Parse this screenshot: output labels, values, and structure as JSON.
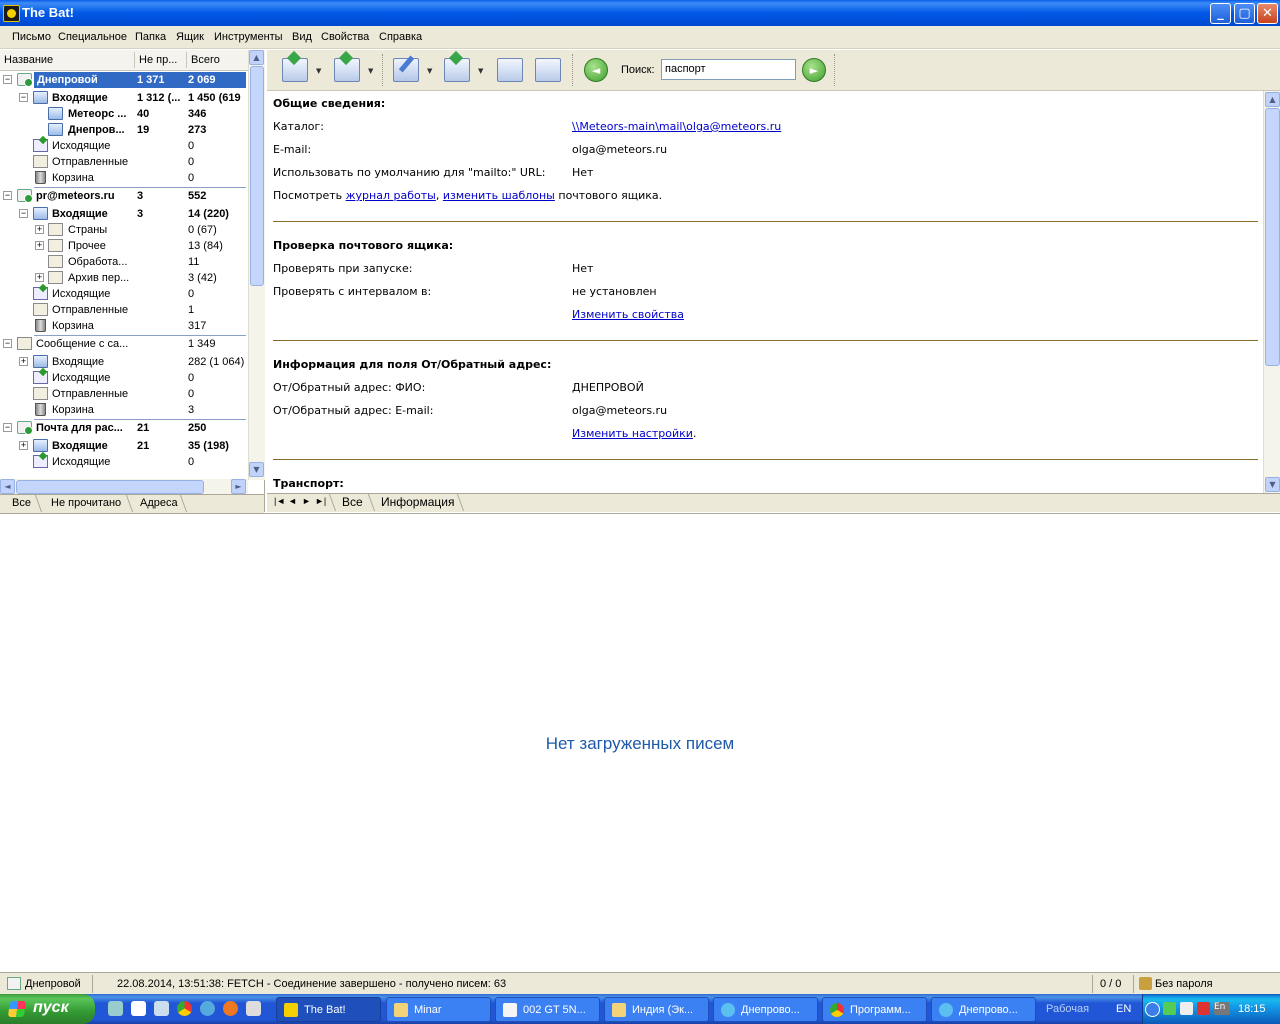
{
  "window": {
    "title": "The Bat!"
  },
  "menu": [
    "Письмо",
    "Специальное",
    "Папка",
    "Ящик",
    "Инструменты",
    "Вид",
    "Свойства",
    "Справка"
  ],
  "tree": {
    "headers": {
      "name": "Название",
      "unread": "Не пр...",
      "total": "Всего"
    },
    "rows": [
      {
        "name": "Днепровой",
        "unread": "1 371",
        "total": "2 069"
      },
      {
        "name": "Входящие",
        "unread": "1 312 (...",
        "total": "1 450 (619"
      },
      {
        "name": "Метеорс ...",
        "unread": "40",
        "total": "346"
      },
      {
        "name": "Днепров...",
        "unread": "19",
        "total": "273"
      },
      {
        "name": "Исходящие",
        "unread": "",
        "total": "0"
      },
      {
        "name": "Отправленные",
        "unread": "",
        "total": "0"
      },
      {
        "name": "Корзина",
        "unread": "",
        "total": "0"
      },
      {
        "name": "pr@meteors.ru",
        "unread": "3",
        "total": "552"
      },
      {
        "name": "Входящие",
        "unread": "3",
        "total": "14 (220)"
      },
      {
        "name": "Страны",
        "unread": "",
        "total": "0 (67)"
      },
      {
        "name": "Прочее",
        "unread": "",
        "total": "13 (84)"
      },
      {
        "name": "Обработа...",
        "unread": "",
        "total": "11"
      },
      {
        "name": "Архив пер...",
        "unread": "",
        "total": "3 (42)"
      },
      {
        "name": "Исходящие",
        "unread": "",
        "total": "0"
      },
      {
        "name": "Отправленные",
        "unread": "",
        "total": "1"
      },
      {
        "name": "Корзина",
        "unread": "",
        "total": "317"
      },
      {
        "name": "Сообщение с са...",
        "unread": "",
        "total": "1 349"
      },
      {
        "name": "Входящие",
        "unread": "",
        "total": "282 (1 064)"
      },
      {
        "name": "Исходящие",
        "unread": "",
        "total": "0"
      },
      {
        "name": "Отправленные",
        "unread": "",
        "total": "0"
      },
      {
        "name": "Корзина",
        "unread": "",
        "total": "3"
      },
      {
        "name": "Почта для рас...",
        "unread": "21",
        "total": "250"
      },
      {
        "name": "Входящие",
        "unread": "21",
        "total": "35 (198)"
      },
      {
        "name": "Исходящие",
        "unread": "",
        "total": "0"
      }
    ],
    "tabs": [
      "Все",
      "Не прочитано",
      "Адреса"
    ]
  },
  "toolbar": {
    "search_label": "Поиск:",
    "search_value": "паспорт"
  },
  "info": {
    "general_title": "Общие сведения:",
    "catalog_label": "Каталог:",
    "catalog_value": "\\\\Meteors-main\\mail\\olga@meteors.ru",
    "email_label": "E-mail:",
    "email_value": "olga@meteors.ru",
    "mailto_label": "Использовать по умолчанию для \"mailto:\" URL:",
    "mailto_value": "Нет",
    "view_prefix": "Посмотреть",
    "log_link": "журнал работы",
    "comma": ",",
    "templates_link": "изменить шаблоны",
    "view_suffix": "почтового ящика.",
    "check_title": "Проверка почтового ящика:",
    "check_start_label": "Проверять при запуске:",
    "check_start_value": "Нет",
    "check_interval_label": "Проверять с интервалом в:",
    "check_interval_value": "не установлен",
    "change_props_link": "Изменить свойства",
    "from_title": "Информация для поля От/Обратный адрес:",
    "from_name_label": "От/Обратный адрес: ФИО:",
    "from_name_value": "ДНЕПРОВОЙ",
    "from_email_label": "От/Обратный адрес: E-mail:",
    "from_email_value": "olga@meteors.ru",
    "change_settings_link": "Изменить настройки",
    "period": ".",
    "transport_title": "Транспорт:"
  },
  "right_tabs": {
    "nav": [
      "|◄",
      "◄",
      "►",
      "►|"
    ],
    "tabs": [
      "Все",
      "Информация"
    ]
  },
  "message_list": {
    "empty_text": "Нет загруженных писем"
  },
  "status": {
    "account": "Днепровой",
    "message": "22.08.2014, 13:51:38: FETCH - Соединение завершено - получено писем: 63",
    "count": "0 / 0",
    "password": "Без пароля"
  },
  "taskbar": {
    "start": "пуск",
    "tasks": [
      "The Bat!",
      "Minar",
      "002 GT 5N...",
      "Индия (Эк...",
      "Днепрово...",
      "Программ...",
      "Днепрово..."
    ],
    "desktop": "Рабочая",
    "lang": "EN",
    "clock": "18:15"
  },
  "colors": {
    "selection": "#316ac5",
    "link": "#0000cc",
    "empty_text": "#1e5aa8",
    "rule": "#8b6b2a"
  }
}
